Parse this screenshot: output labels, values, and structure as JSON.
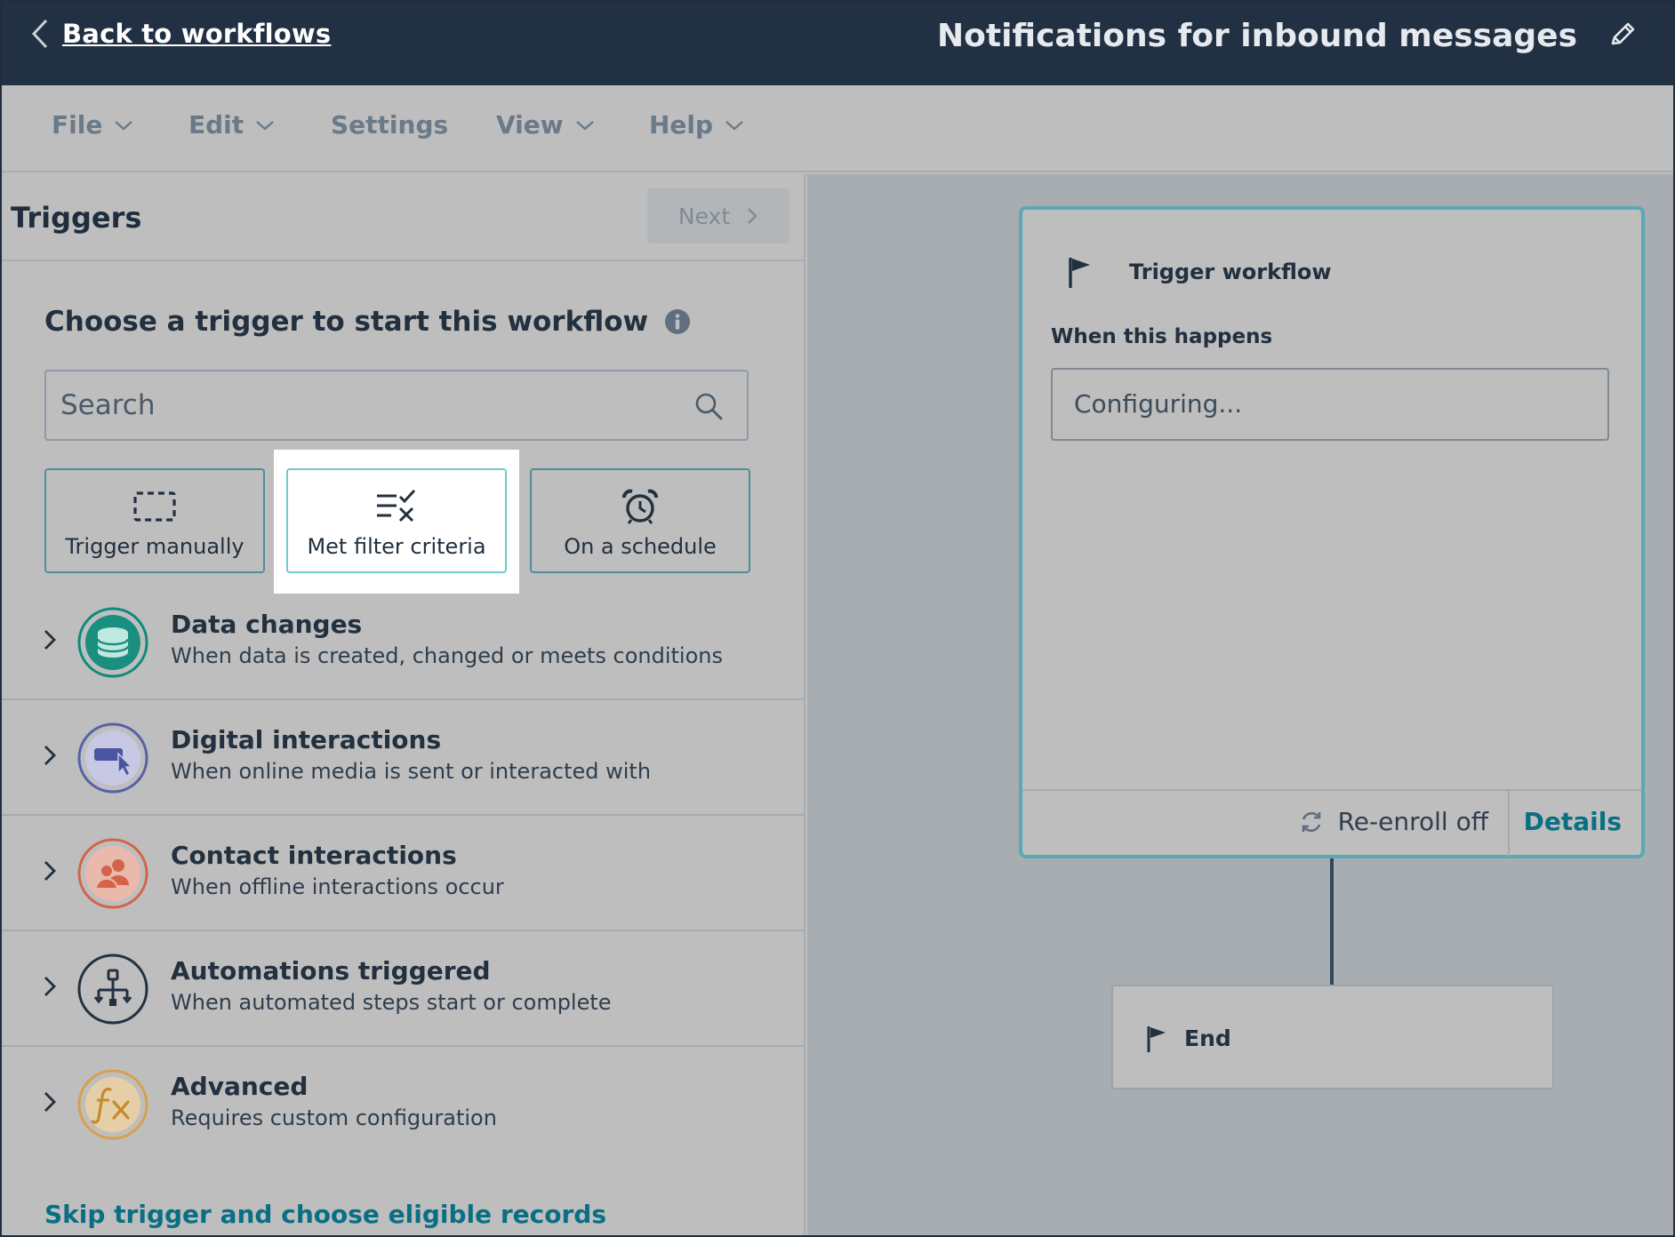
{
  "topbar": {
    "back_label": "Back to workflows",
    "workflow_title": "Notifications for inbound messages"
  },
  "menu": {
    "items": [
      {
        "label": "File",
        "has_dropdown": true
      },
      {
        "label": "Edit",
        "has_dropdown": true
      },
      {
        "label": "Settings",
        "has_dropdown": false
      },
      {
        "label": "View",
        "has_dropdown": true
      },
      {
        "label": "Help",
        "has_dropdown": true
      }
    ]
  },
  "triggers_panel": {
    "title": "Triggers",
    "next_label": "Next",
    "heading": "Choose a trigger to start this workflow",
    "search": {
      "placeholder": "Search",
      "value": ""
    },
    "trigger_types": [
      {
        "label": "Trigger manually",
        "icon": "dashed-box-icon"
      },
      {
        "label": "Met filter criteria",
        "icon": "filter-criteria-icon",
        "highlighted": true
      },
      {
        "label": "On a schedule",
        "icon": "alarm-clock-icon"
      }
    ],
    "categories": [
      {
        "title": "Data changes",
        "description": "When data is created, changed or meets conditions",
        "icon": "database-icon",
        "color": "#0e8a7e"
      },
      {
        "title": "Digital interactions",
        "description": "When online media is sent or interacted with",
        "icon": "cursor-click-icon",
        "color": "#5561a8"
      },
      {
        "title": "Contact interactions",
        "description": "When offline interactions occur",
        "icon": "contacts-icon",
        "color": "#d4634a"
      },
      {
        "title": "Automations triggered",
        "description": "When automated steps start or complete",
        "icon": "workflow-tree-icon",
        "color": "#22303f"
      },
      {
        "title": "Advanced",
        "description": "Requires custom configuration",
        "icon": "function-fx-icon",
        "color": "#d9a04a"
      }
    ],
    "skip_link": "Skip trigger and choose eligible records"
  },
  "canvas": {
    "trigger_card": {
      "title": "Trigger workflow",
      "when_label": "When this happens",
      "config_text": "Configuring...",
      "reenroll_label": "Re-enroll off",
      "details_label": "Details"
    },
    "end_card": {
      "label": "End"
    }
  },
  "colors": {
    "topbar": "#213042",
    "accent_teal": "#0a6f85",
    "card_border": "#5aa9b5"
  }
}
